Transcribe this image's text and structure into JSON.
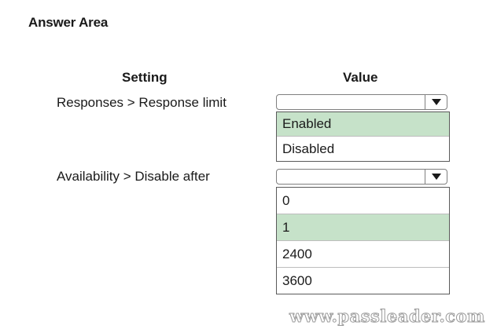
{
  "answer_area": {
    "title": "Answer Area"
  },
  "columns": {
    "setting": "Setting",
    "value": "Value"
  },
  "rows": [
    {
      "setting": "Responses > Response limit",
      "dropdown_value": "",
      "options": [
        "Enabled",
        "Disabled"
      ],
      "selected_option": "Enabled"
    },
    {
      "setting": "Availability > Disable after",
      "dropdown_value": "",
      "options": [
        "0",
        "1",
        "2400",
        "3600"
      ],
      "selected_option": "1"
    }
  ],
  "colors": {
    "selected_highlight": "#c6e2c9",
    "border": "#7f7f7f"
  },
  "icons": {
    "dropdown_arrow": "chevron-down-icon"
  },
  "watermark": "www.passleader.com"
}
